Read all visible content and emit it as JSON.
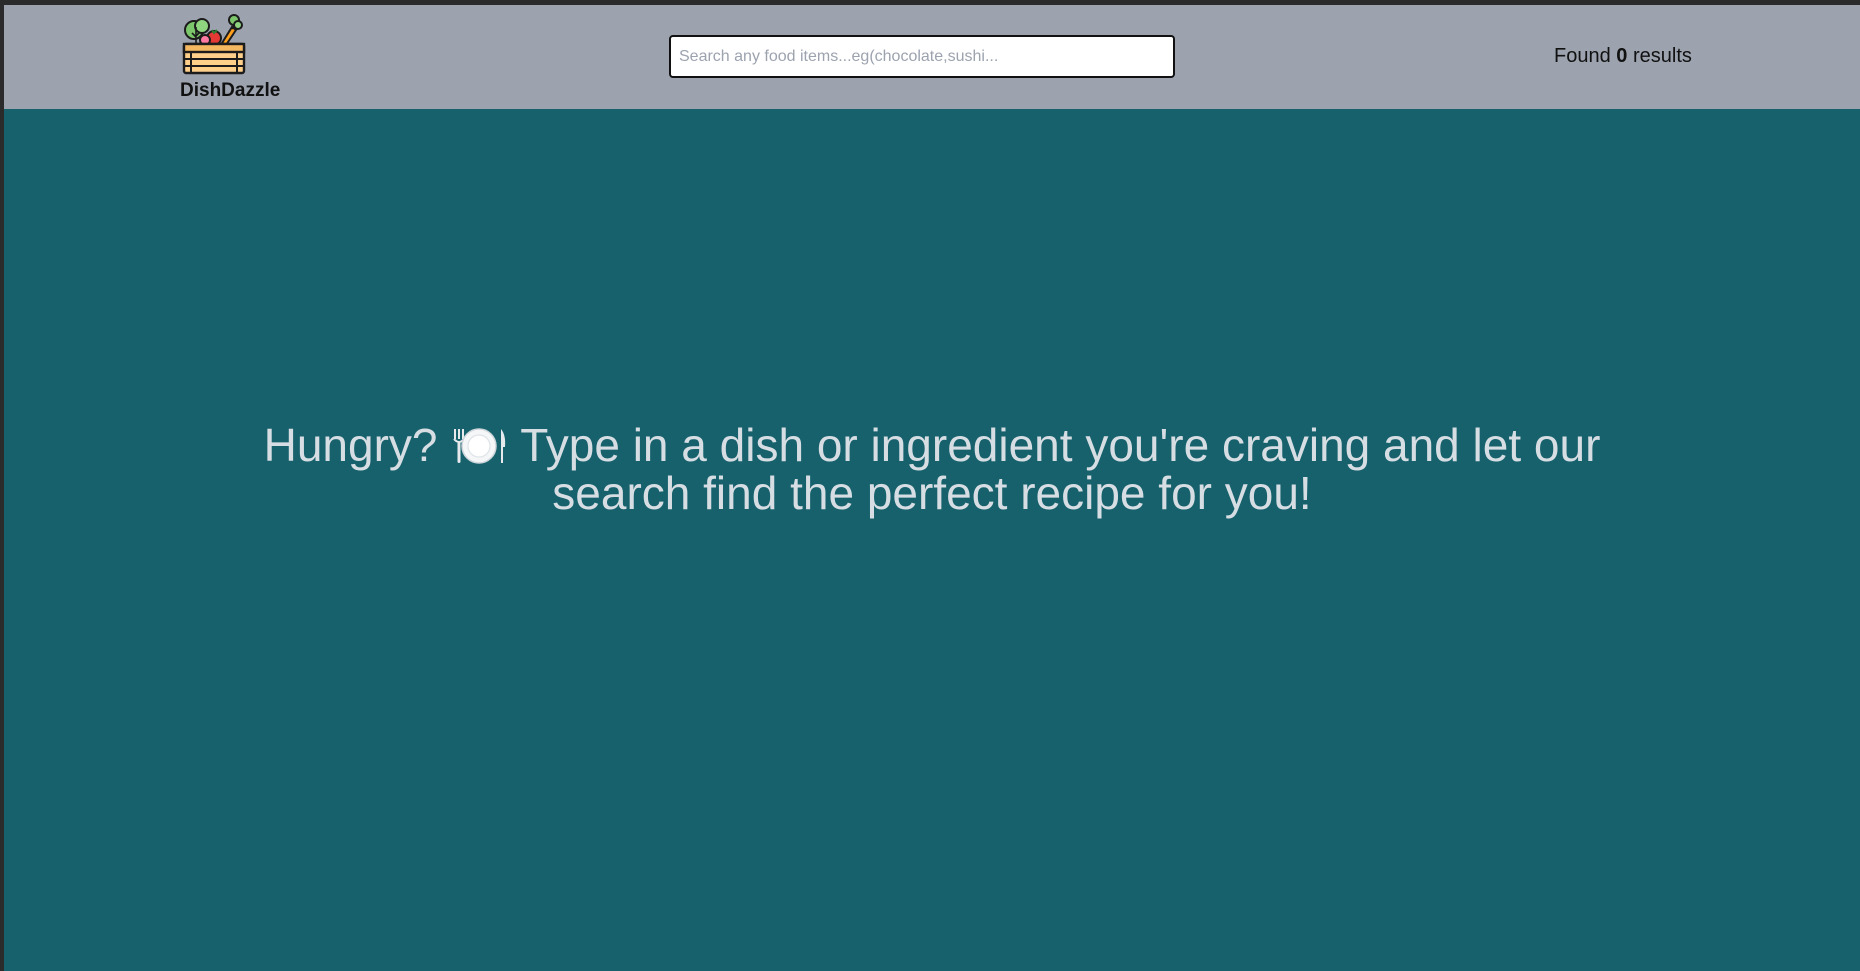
{
  "brand": {
    "name": "DishDazzle",
    "logo_icon": "vegetable-crate-icon"
  },
  "search": {
    "placeholder": "Search any food items...eg(chocolate,sushi...",
    "value": ""
  },
  "results": {
    "prefix": "Found",
    "count": "0",
    "suffix": "results"
  },
  "hero": {
    "lead": "Hungry?",
    "icon": "plate-with-cutlery-icon",
    "text": "Type in a dish or ingredient you're craving and let our search find the perfect recipe for you!"
  },
  "colors": {
    "navbar": "#9ca3af",
    "background": "#16616c",
    "hero_text": "#d6dde3"
  }
}
